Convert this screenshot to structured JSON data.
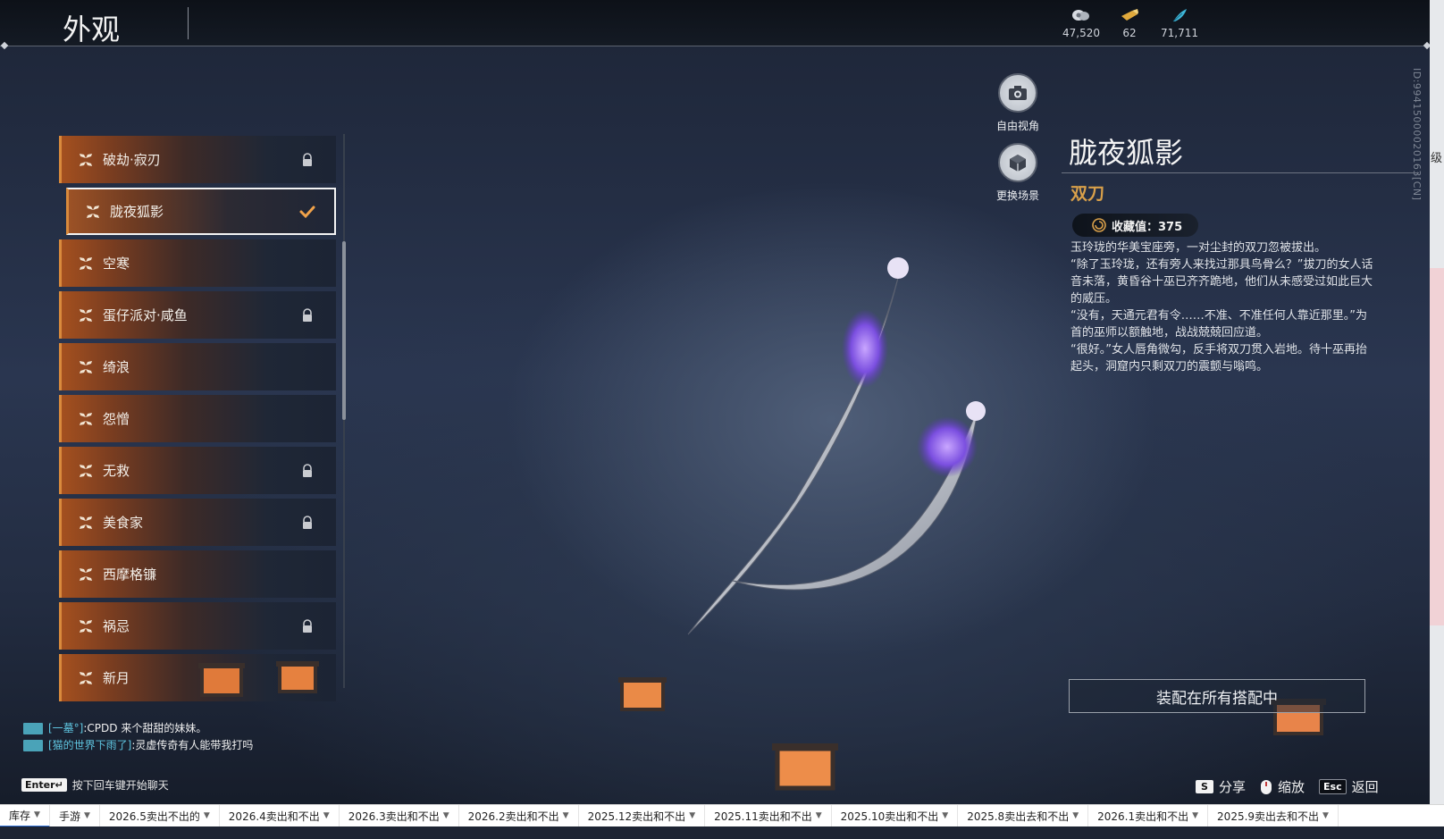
{
  "header": {
    "title": "外观",
    "currencies": [
      {
        "icon": "silver-coin-icon",
        "value": "47,520"
      },
      {
        "icon": "gold-ticket-icon",
        "value": "62"
      },
      {
        "icon": "feather-icon",
        "value": "71,711"
      }
    ]
  },
  "side_id": "ID:99415000020163[CN]",
  "edge_label": "级",
  "skin_list": [
    {
      "name": "破劫·寂刃",
      "locked": true
    },
    {
      "name": "胧夜狐影",
      "selected": true
    },
    {
      "name": "空寒"
    },
    {
      "name": "蛋仔派对·咸鱼",
      "locked": true
    },
    {
      "name": "绮浪"
    },
    {
      "name": "怨憎"
    },
    {
      "name": "无救",
      "locked": true
    },
    {
      "name": "美食家",
      "locked": true
    },
    {
      "name": "西摩格镰"
    },
    {
      "name": "祸忌",
      "locked": true
    },
    {
      "name": "新月",
      "locked": true
    }
  ],
  "view_buttons": {
    "free_view": "自由视角",
    "change_scene": "更换场景"
  },
  "detail": {
    "title": "胧夜狐影",
    "type": "双刀",
    "collect_label": "收藏值：375",
    "description": [
      "玉玲珑的华美宝座旁，一对尘封的双刀忽被拔出。",
      "“除了玉玲珑，还有旁人来找过那具鸟骨么？”拔刀的女人话音未落，黄昏谷十巫已齐齐跪地，他们从未感受过如此巨大的威压。",
      "“没有，天通元君有令……不准、不准任何人靠近那里。”为首的巫师以额触地，战战兢兢回应道。",
      "“很好。”女人唇角微勾，反手将双刀贯入岩地。待十巫再抬起头，洞窟内只剩双刀的震颤与嗡鸣。"
    ],
    "equip_button": "装配在所有搭配中"
  },
  "chat": {
    "messages": [
      {
        "channel": "[一墓°]",
        "text": ":CPDD 来个甜甜的妹妹。"
      },
      {
        "channel": "[猫的世界下雨了]",
        "text": ":灵虚传奇有人能带我打吗"
      }
    ],
    "enter_key": "Enter↵",
    "enter_hint": "按下回车键开始聊天"
  },
  "hotkeys": [
    {
      "key": "S",
      "label": "分享"
    },
    {
      "key": "",
      "label": "缩放",
      "icon": "mouse-icon"
    },
    {
      "key": "Esc",
      "label": "返回"
    }
  ],
  "taskbar_tabs": [
    {
      "label": "库存",
      "active": true
    },
    {
      "label": "手游"
    },
    {
      "label": "2026.5卖出不出的"
    },
    {
      "label": "2026.4卖出和不出"
    },
    {
      "label": "2026.3卖出和不出"
    },
    {
      "label": "2026.2卖出和不出"
    },
    {
      "label": "2025.12卖出和不出"
    },
    {
      "label": "2025.11卖出和不出"
    },
    {
      "label": "2025.10卖出和不出"
    },
    {
      "label": "2025.8卖出去和不出"
    },
    {
      "label": "2026.1卖出和不出"
    },
    {
      "label": "2025.9卖出去和不出"
    }
  ],
  "colors": {
    "accent_orange": "#d98a3c",
    "type_gold": "#d9a04a",
    "chat_channel": "#5fc5e0"
  }
}
